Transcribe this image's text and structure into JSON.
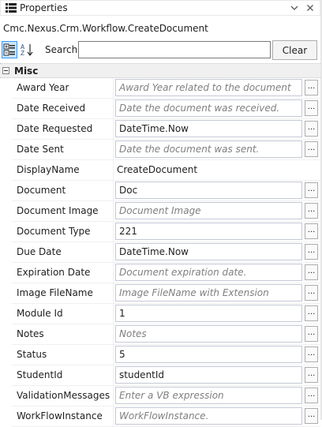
{
  "window": {
    "title": "Properties",
    "pin_icon": "pin-icon",
    "close_icon": "close-icon"
  },
  "type_label": "Cmc.Nexus.Crm.Workflow.CreateDocument",
  "toolbar": {
    "categorized_icon": "categorized-icon",
    "alphabetical_icon": "alphabetical-sort-icon",
    "search_label": "Search:",
    "search_value": "",
    "clear_label": "Clear"
  },
  "grid": {
    "category": "Misc",
    "properties": [
      {
        "name": "Award Year",
        "value": "Award Year related to the document",
        "placeholder": true,
        "ellipsis": "..."
      },
      {
        "name": "Date Received",
        "value": "Date the document was received.",
        "placeholder": true,
        "ellipsis": "..."
      },
      {
        "name": "Date Requested",
        "value": "DateTime.Now",
        "placeholder": false,
        "ellipsis": "..."
      },
      {
        "name": "Date Sent",
        "value": "Date the document was sent.",
        "placeholder": true,
        "ellipsis": "..."
      },
      {
        "name": "DisplayName",
        "value": "CreateDocument",
        "placeholder": false,
        "plain": true
      },
      {
        "name": "Document",
        "value": "Doc",
        "placeholder": false,
        "ellipsis": "..."
      },
      {
        "name": "Document Image",
        "value": "Document Image",
        "placeholder": true,
        "ellipsis": "..."
      },
      {
        "name": "Document Type",
        "value": "221",
        "placeholder": false,
        "ellipsis": "..."
      },
      {
        "name": "Due Date",
        "value": "DateTime.Now",
        "placeholder": false,
        "ellipsis": "..."
      },
      {
        "name": "Expiration Date",
        "value": "Document expiration date.",
        "placeholder": true,
        "ellipsis": "..."
      },
      {
        "name": "Image FileName",
        "value": "Image FileName with Extension",
        "placeholder": true,
        "ellipsis": "..."
      },
      {
        "name": "Module Id",
        "value": "1",
        "placeholder": false,
        "ellipsis": "..."
      },
      {
        "name": "Notes",
        "value": "Notes",
        "placeholder": true,
        "ellipsis": "..."
      },
      {
        "name": "Status",
        "value": "5",
        "placeholder": false,
        "ellipsis": "..."
      },
      {
        "name": "StudentId",
        "value": "studentId",
        "placeholder": false,
        "ellipsis": "..."
      },
      {
        "name": "ValidationMessages",
        "value": "Enter a VB expression",
        "placeholder": true,
        "ellipsis": "..."
      },
      {
        "name": "WorkFlowInstance",
        "value": "WorkFlowInstance.",
        "placeholder": true,
        "ellipsis": "..."
      }
    ]
  }
}
